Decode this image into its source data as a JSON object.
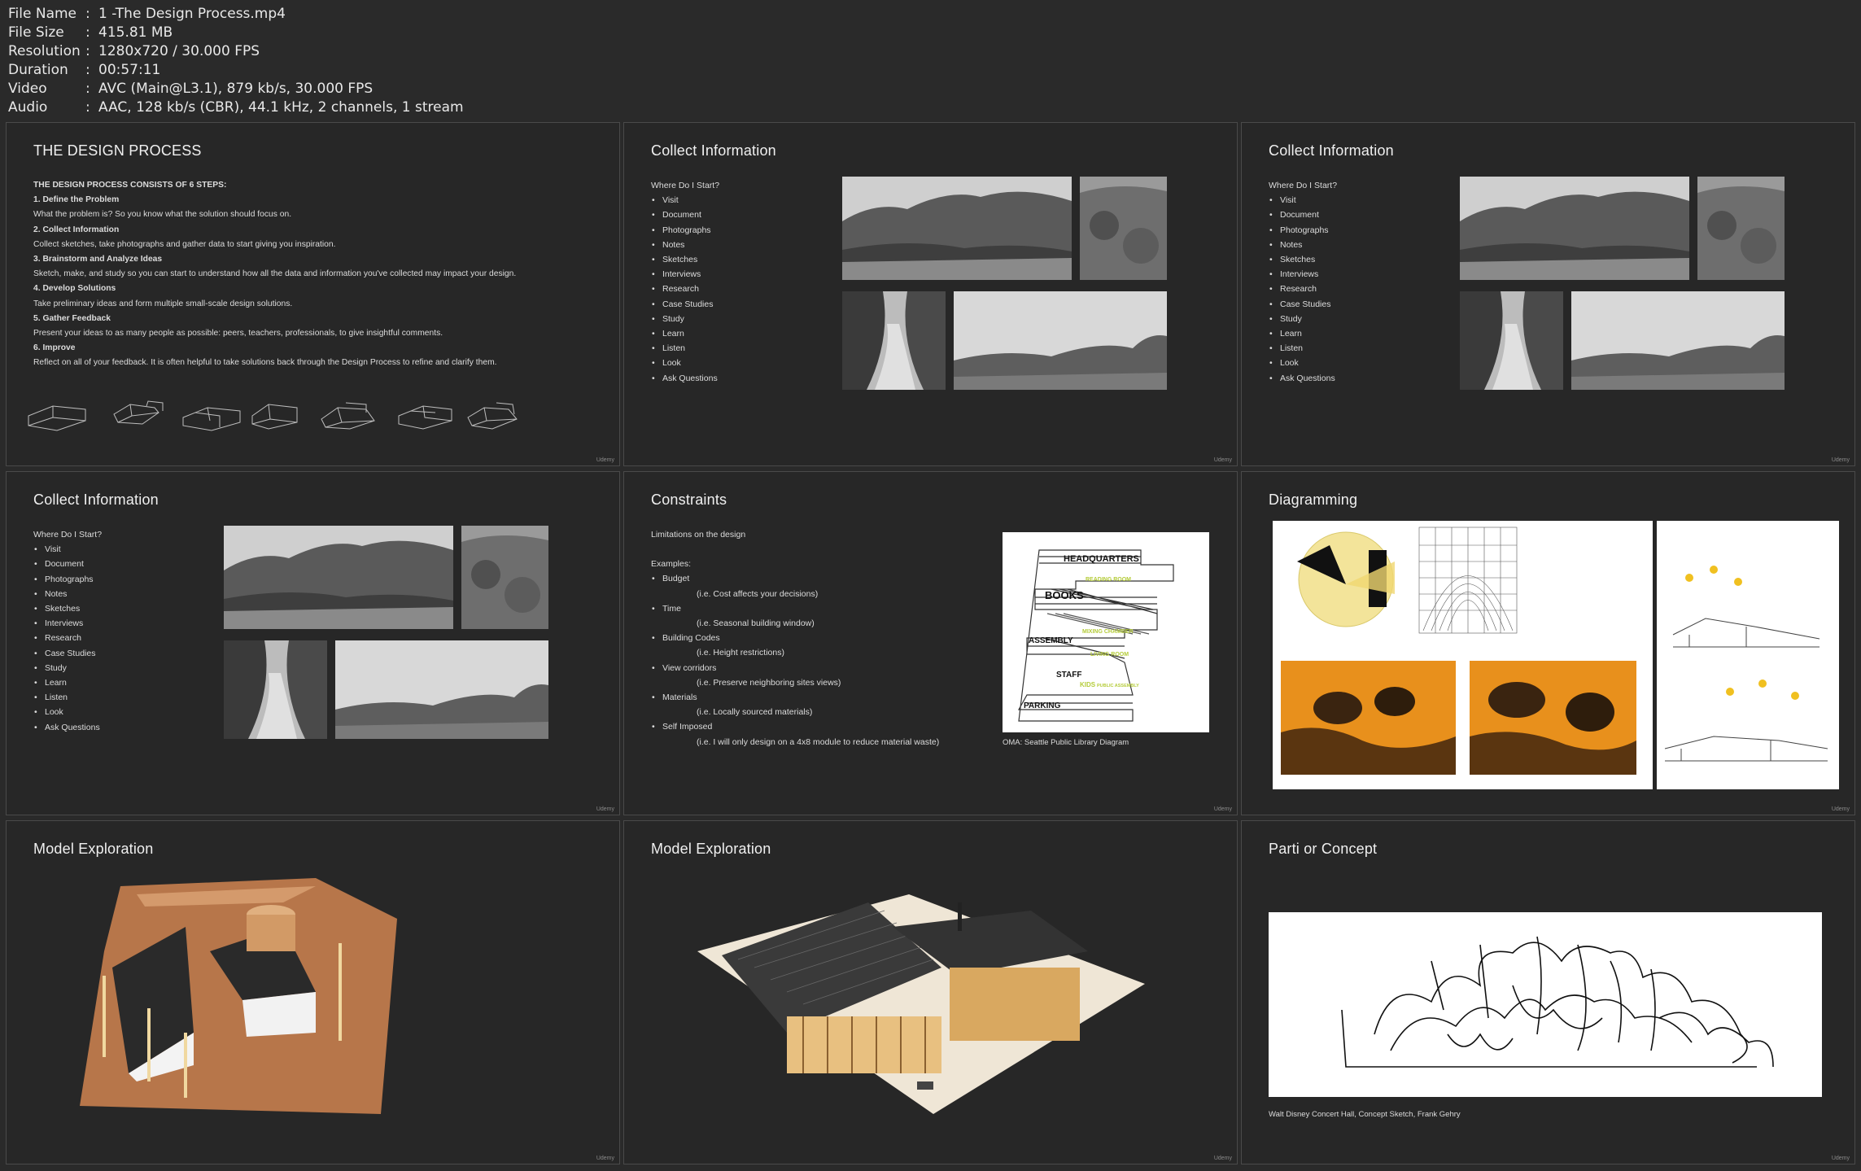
{
  "header": {
    "rows": [
      {
        "key": "File Name",
        "value": "1 -The Design Process.mp4"
      },
      {
        "key": "File Size",
        "value": "415.81 MB"
      },
      {
        "key": "Resolution",
        "value": "1280x720 / 30.000 FPS"
      },
      {
        "key": "Duration",
        "value": "00:57:11"
      },
      {
        "key": "Video",
        "value": "AVC (Main@L3.1), 879 kb/s, 30.000 FPS"
      },
      {
        "key": "Audio",
        "value": "AAC, 128 kb/s (CBR), 44.1 kHz, 2 channels, 1 stream"
      }
    ]
  },
  "watermark": "Udemy",
  "slide1": {
    "title": "THE DESIGN PROCESS",
    "lines": [
      {
        "text": "THE DESIGN PROCESS CONSISTS OF 6 STEPS:",
        "bold": true
      },
      {
        "text": "1. Define the Problem",
        "bold": true
      },
      {
        "text": "What the problem is?  So you know what the solution should focus on.",
        "bold": false
      },
      {
        "text": "2. Collect Information",
        "bold": true
      },
      {
        "text": "Collect sketches, take photographs and gather data to start giving you inspiration.",
        "bold": false
      },
      {
        "text": "3. Brainstorm and Analyze Ideas",
        "bold": true
      },
      {
        "text": "Sketch, make, and study so you can start to understand how all the data and information you've collected may impact your design.",
        "bold": false
      },
      {
        "text": "4. Develop Solutions",
        "bold": true
      },
      {
        "text": "Take preliminary ideas and form multiple small-scale design solutions.",
        "bold": false
      },
      {
        "text": "5. Gather Feedback",
        "bold": true
      },
      {
        "text": "Present your ideas to as many people as possible: peers, teachers, professionals, to give insightful comments.",
        "bold": false
      },
      {
        "text": "6. Improve",
        "bold": true
      },
      {
        "text": "Reflect on all of your feedback. It is often helpful to take solutions back through the Design Process to refine and clarify them.",
        "bold": false
      }
    ]
  },
  "collect": {
    "title": "Collect Information",
    "intro": "Where Do I Start?",
    "items": [
      "Visit",
      "Document",
      "Photographs",
      "Notes",
      "Sketches",
      "Interviews",
      "Research",
      "Case Studies",
      "Study",
      "Learn",
      "Listen",
      "Look",
      "Ask Questions"
    ]
  },
  "constraints": {
    "title": "Constraints",
    "intro": "Limitations on the design",
    "examples_label": "Examples:",
    "items": [
      {
        "label": "Budget",
        "sub": "(i.e. Cost affects your decisions)"
      },
      {
        "label": "Time",
        "sub": "(i.e. Seasonal building window)"
      },
      {
        "label": "Building Codes",
        "sub": "(i.e. Height restrictions)"
      },
      {
        "label": "View corridors",
        "sub": "(i.e. Preserve neighboring sites views)"
      },
      {
        "label": "Materials",
        "sub": "(i.e. Locally sourced materials)"
      },
      {
        "label": "Self Imposed",
        "sub": "(i.e. I will only design on a 4x8 module to reduce material waste)"
      }
    ],
    "diagram_labels": {
      "hq": "HEADQUARTERS",
      "reading": "READING ROOM",
      "books": "BOOKS",
      "mixing": "MIXING CHAMBER",
      "assembly": "ASSEMBLY",
      "living": "LIVING ROOM",
      "staff": "STAFF",
      "kids": "KIDS",
      "public": "PUBLIC ASSEMBLY",
      "parking": "PARKING"
    },
    "caption": "OMA: Seattle Public Library Diagram"
  },
  "diagramming": {
    "title": "Diagramming"
  },
  "model1": {
    "title": "Model Exploration"
  },
  "model2": {
    "title": "Model Exploration"
  },
  "parti": {
    "title": "Parti or Concept",
    "caption": "Walt Disney Concert Hall, Concept Sketch, Frank Gehry"
  },
  "colors": {
    "background": "#2a2a2a",
    "slide": "#272727",
    "accent_yellow": "#b5cc3a",
    "accent_orange": "#e8901c"
  }
}
